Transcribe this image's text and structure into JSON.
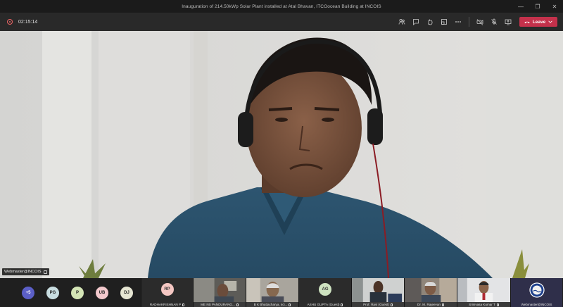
{
  "window": {
    "title": "Inauguration of 214.50kWp Solar Plant installed at Atal Bhavan, ITCOocean Building at INCOIS",
    "controls": [
      "minimize",
      "restore",
      "close"
    ]
  },
  "toolbar": {
    "timer": "02:15:14",
    "icons": [
      "participants-icon",
      "chat-icon",
      "raise-hand-icon",
      "breakout-icon",
      "more-icon",
      "camera-off-icon",
      "mic-off-icon",
      "share-icon"
    ],
    "leave_label": "Leave"
  },
  "main_video": {
    "presenter_name": "Webmaster@INCOIS"
  },
  "strip": {
    "overflow_count": "+5",
    "avatars": [
      {
        "initials": "PG",
        "color": "#c8dde0"
      },
      {
        "initials": "P",
        "color": "#d4e5b6"
      },
      {
        "initials": "UB",
        "color": "#f3c9cd"
      },
      {
        "initials": "DJ",
        "color": "#e5e5d2"
      }
    ],
    "tiles": [
      {
        "name": "RADHAKRISHNAN P",
        "initials": "RP",
        "avatar_color": "#f4c7c3",
        "type": "avatar"
      },
      {
        "name": "ME NS PANDURANG...",
        "type": "video"
      },
      {
        "name": "B K Bhattacharya, sci...",
        "type": "video"
      },
      {
        "name": "ASHU GUPTA (Guest)",
        "initials": "AG",
        "avatar_color": "#cfe3c1",
        "type": "avatar"
      },
      {
        "name": "Prof. Ravi (Guest)",
        "type": "video"
      },
      {
        "name": "Dr. M. Rajeevan",
        "type": "video"
      },
      {
        "name": "Srinivasa Kumar T",
        "type": "video"
      },
      {
        "name": "Webmaster@INCOIS",
        "type": "logo"
      }
    ]
  }
}
